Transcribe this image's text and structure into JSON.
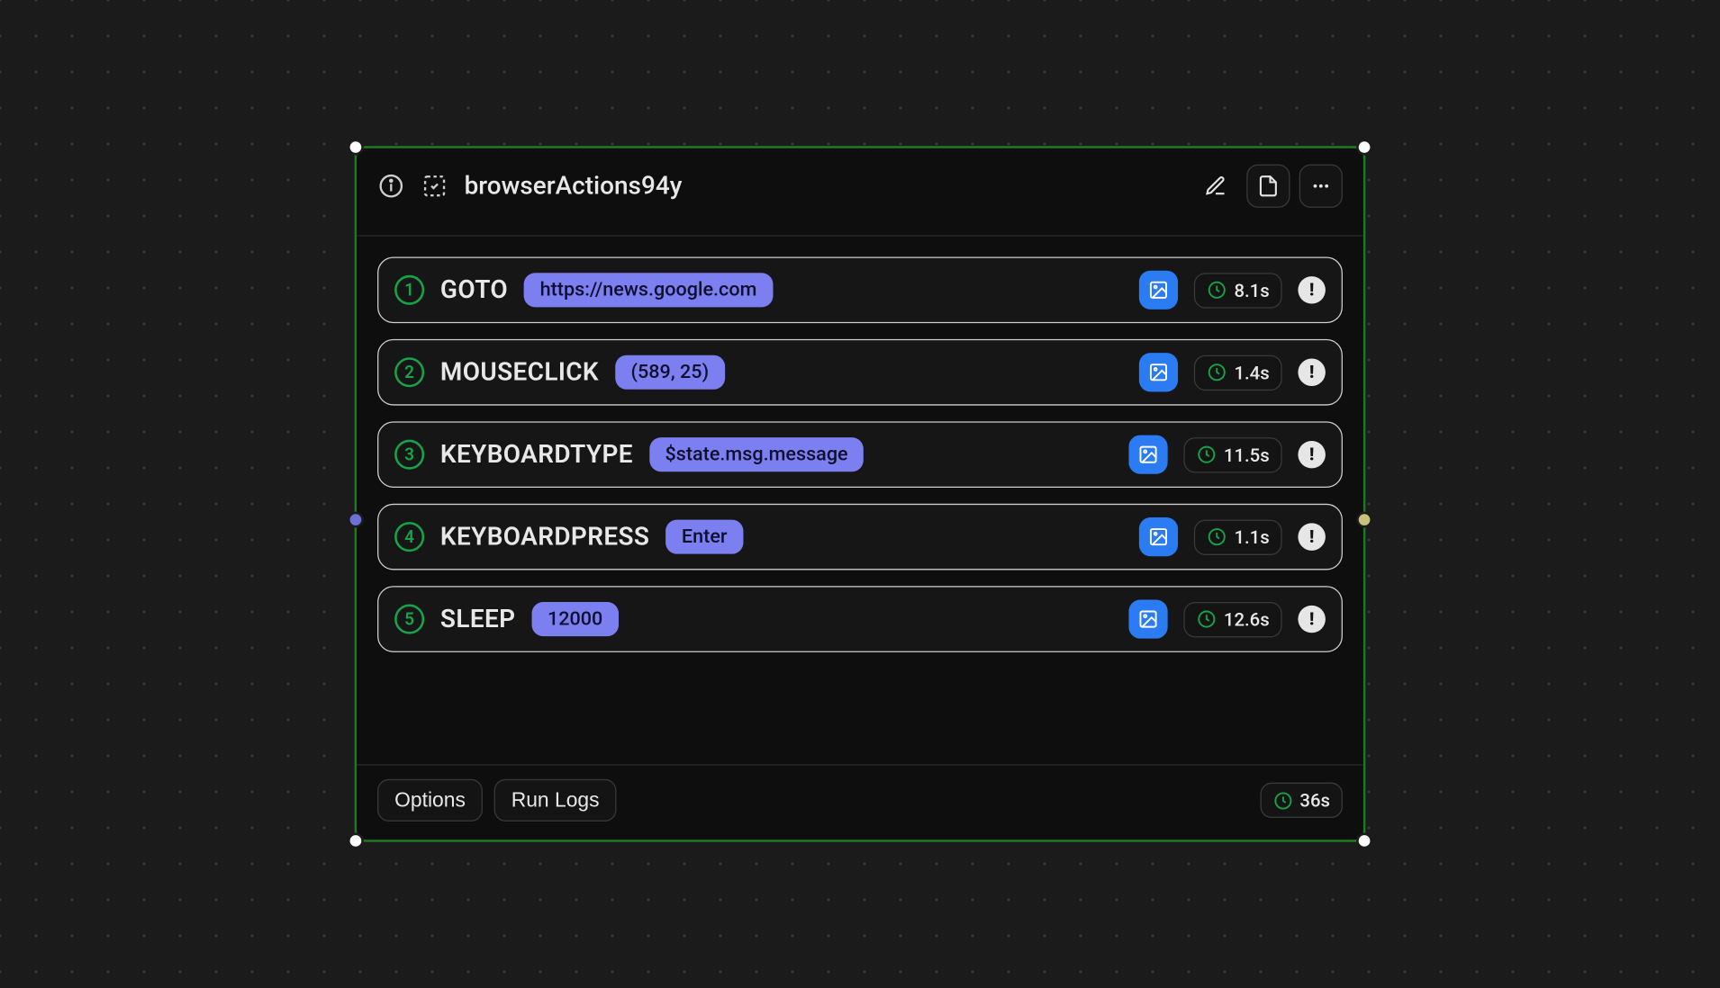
{
  "header": {
    "title": "browserActions94y"
  },
  "actions": [
    {
      "num": "1",
      "name": "GOTO",
      "arg": "https://news.google.com",
      "duration": "8.1s"
    },
    {
      "num": "2",
      "name": "MOUSECLICK",
      "arg": "(589, 25)",
      "duration": "1.4s"
    },
    {
      "num": "3",
      "name": "KEYBOARDTYPE",
      "arg": "$state.msg.message",
      "duration": "11.5s"
    },
    {
      "num": "4",
      "name": "KEYBOARDPRESS",
      "arg": "Enter",
      "duration": "1.1s"
    },
    {
      "num": "5",
      "name": "SLEEP",
      "arg": "12000",
      "duration": "12.6s"
    }
  ],
  "footer": {
    "options_label": "Options",
    "runlogs_label": "Run Logs",
    "total_duration": "36s"
  }
}
